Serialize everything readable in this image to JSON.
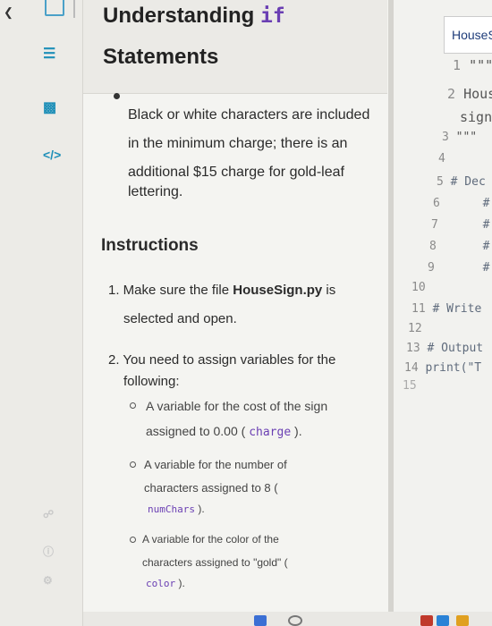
{
  "rail": {
    "icons": [
      "chevron-left-icon",
      "checklist-icon",
      "bar-chart-icon",
      "code-icon",
      "share-icon",
      "help-icon",
      "settings-icon"
    ]
  },
  "lesson": {
    "title_part1": "Understanding ",
    "title_code": "if",
    "title_part2": "Statements",
    "bullet_lines": [
      "Black or white characters are included",
      "in the minimum charge; there is an",
      "additional $15 charge for gold-leaf",
      "lettering."
    ],
    "instructions_heading": "Instructions",
    "step1_prefix": "1. Make sure the file ",
    "step1_file": "HouseSign.py",
    "step1_suffix": " is",
    "step1_line2": "selected and open.",
    "step2_line1": "2. You need to assign variables for the",
    "step2_line2": "following:",
    "sub1_line1": "A variable for the cost of the sign",
    "sub1_line2_prefix": "assigned to 0.00 ( ",
    "sub1_code": "charge",
    "sub1_suffix": " ).",
    "sub2_line1": "A variable for the number of",
    "sub2_line2": "characters assigned to 8 (",
    "sub2_code": "numChars",
    "sub2_suffix": " ).",
    "sub3_line1": "A variable for the color of the",
    "sub3_line2": "characters assigned to \"gold\" (",
    "sub3_code": "color",
    "sub3_suffix": " )."
  },
  "editor": {
    "tab_label": "HouseS",
    "lines": [
      {
        "num": "1",
        "text": "\"\"\""
      },
      {
        "num": "2",
        "text": "Hous"
      },
      {
        "num": "",
        "text": "sign"
      },
      {
        "num": "3",
        "text": "\"\"\""
      },
      {
        "num": "4",
        "text": ""
      },
      {
        "num": "5",
        "text": "# Dec"
      },
      {
        "num": "6",
        "text": "#"
      },
      {
        "num": "7",
        "text": "#"
      },
      {
        "num": "8",
        "text": "#"
      },
      {
        "num": "9",
        "text": "#"
      },
      {
        "num": "10",
        "text": ""
      },
      {
        "num": "11",
        "text": "# Write"
      },
      {
        "num": "12",
        "text": ""
      },
      {
        "num": "13",
        "text": "# Output"
      },
      {
        "num": "14",
        "text": "print(\"T"
      },
      {
        "num": "15",
        "text": ""
      }
    ]
  }
}
